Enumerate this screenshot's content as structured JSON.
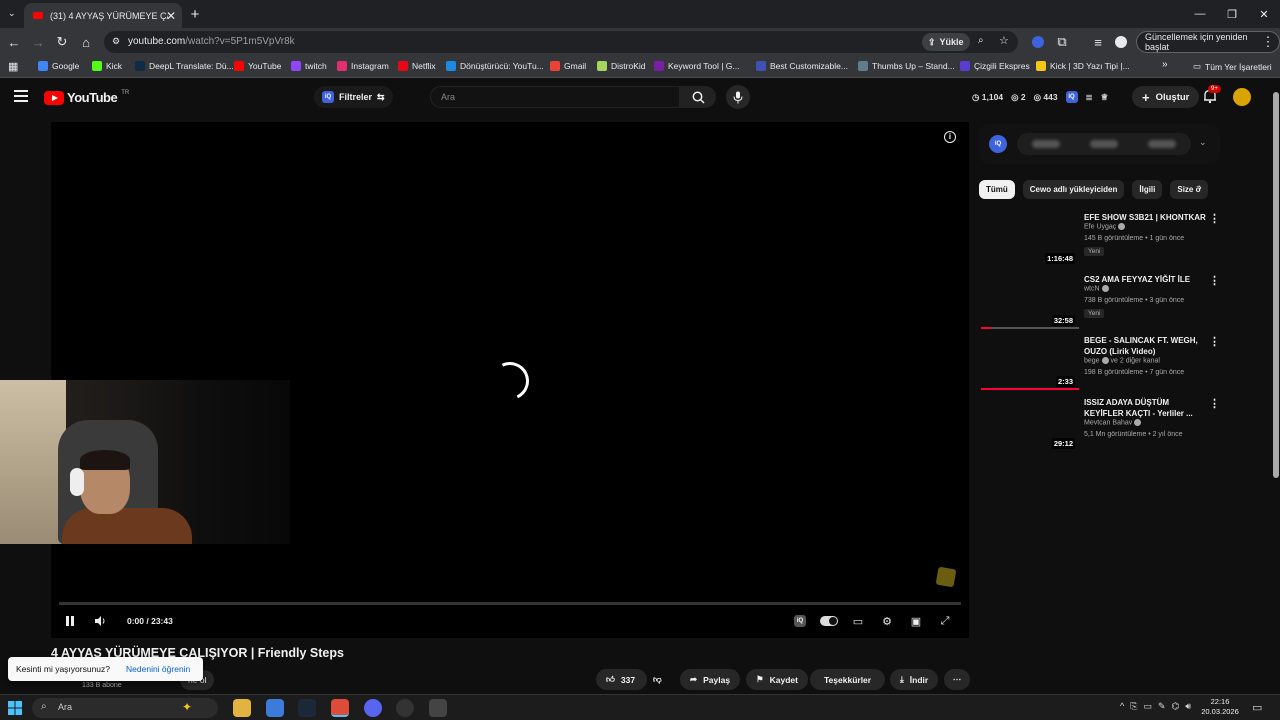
{
  "browser": {
    "tab_title": "(31) 4 AYYAŞ YÜRÜMEYE ÇALIŞ",
    "url_host": "youtube.com",
    "url_path": "/watch?v=5P1m5VpVr8k",
    "upload_label": "Yükle",
    "update_label": "Güncellemek için yeniden başlat",
    "all_bookmarks_label": "Tüm Yer İşaretleri",
    "bookmarks": [
      {
        "label": "Google",
        "color": "#4285f4"
      },
      {
        "label": "Kick",
        "color": "#53fc18"
      },
      {
        "label": "DeepL Translate: Dü...",
        "color": "#0f2b46"
      },
      {
        "label": "YouTube",
        "color": "#ff0000"
      },
      {
        "label": "twitch",
        "color": "#9146ff"
      },
      {
        "label": "Instagram",
        "color": "#e1306c"
      },
      {
        "label": "Netflix",
        "color": "#e50914"
      },
      {
        "label": "Dönüştürücü: YouTu...",
        "color": "#1e88e5"
      },
      {
        "label": "Gmail",
        "color": "#ea4335"
      },
      {
        "label": "DistroKid",
        "color": "#a4d65e"
      },
      {
        "label": "Keyword Tool | G...",
        "color": "#7b1fa2"
      },
      {
        "label": "Best Customizable...",
        "color": "#3f51b5"
      },
      {
        "label": "Thumbs Up – Stand...",
        "color": "#607d8b"
      },
      {
        "label": "Çizgili Ekspres",
        "color": "#5c3bd1"
      },
      {
        "label": "Kick | 3D Yazı Tipi |...",
        "color": "#f5c518"
      }
    ]
  },
  "youtube": {
    "logo_text": "YouTube",
    "logo_region": "TR",
    "filters_label": "Filtreler",
    "iq_label": "iQ",
    "search_placeholder": "Ara",
    "stats": {
      "likes": "1,104",
      "views_a": "2",
      "views_b": "443"
    },
    "create_label": "Oluştur",
    "notif_count": "9+"
  },
  "player": {
    "timecode": "0:00 / 23:43",
    "progress": 0.0
  },
  "video": {
    "title": "4 AYYAŞ YÜRÜMEYE ÇALIŞIYOR | Friendly Steps",
    "subscribers": "133 B abone",
    "join_label": "ne ol",
    "popup_question": "Kesinti mi yaşıyorsunuz?",
    "popup_link": "Nedenini öğrenin",
    "likes": "337",
    "share_label": "Paylaş",
    "save_label": "Kaydet",
    "thanks_label": "Teşekkürler",
    "download_label": "İndir"
  },
  "sidebar": {
    "chips": [
      "Tümü",
      "Cewo adlı yükleyiciden",
      "İlgili",
      "Size ö"
    ],
    "recommendations": [
      {
        "title": "EFE SHOW S3B21 | KHONTKAR",
        "channel": "Efe Uygaç",
        "meta": "145 B görüntüleme • 1 gün önce",
        "badge": "Yeni",
        "duration": "1:16:48",
        "watched": 0
      },
      {
        "title": "CS2 AMA FEYYAZ YİĞİT İLE",
        "channel": "wtcN",
        "meta": "738 B görüntüleme • 3 gün önce",
        "badge": "Yeni",
        "duration": "32:58",
        "watched": 0.1
      },
      {
        "title": "BEGE - SALINCAK FT. WEGH, OUZO (Lirik Video)",
        "channel": "bege",
        "channel_extra": "ve 2 diğer kanal",
        "meta": "198 B görüntüleme • 7 gün önce",
        "badge": "",
        "duration": "2:33",
        "watched": 1.0
      },
      {
        "title": "ISSIZ ADAYA DÜŞTÜM KEYİFLER KAÇTI - Yerliler ...",
        "channel": "Mevtcan Bahav",
        "meta": "5,1 Mn görüntüleme • 2 yıl önce",
        "badge": "",
        "duration": "29:12",
        "watched": 0
      }
    ]
  },
  "taskbar": {
    "search_label": "Ara",
    "time": "22:16",
    "date": "20.03.2026"
  },
  "colors": {
    "youtube_red": "#ff0000",
    "progress_red": "#ff0033",
    "iq_blue": "#3e63dd"
  }
}
